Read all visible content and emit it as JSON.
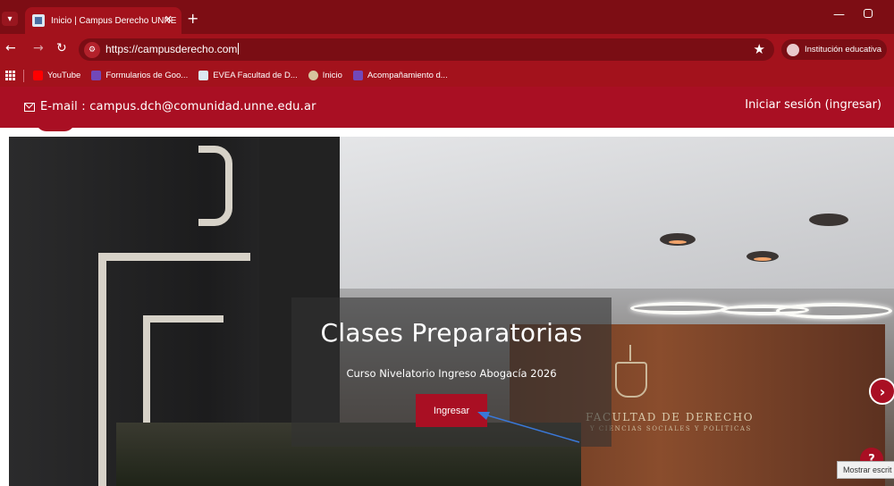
{
  "browser": {
    "tab": {
      "title": "Inicio | Campus Derecho UNNE",
      "close_glyph": "✕"
    },
    "new_tab_glyph": "+",
    "url": "https://campusderecho.com",
    "profile_label": "Institución educativa",
    "bookmarks": [
      {
        "label": "YouTube",
        "icon": "youtube-icon",
        "color": "#ff0000"
      },
      {
        "label": "Formularios de Goo...",
        "icon": "google-forms-icon",
        "color": "#7248b9"
      },
      {
        "label": "EVEA Facultad de D...",
        "icon": "evea-icon",
        "color": "#dce8f3"
      },
      {
        "label": "Inicio",
        "icon": "inicio-icon",
        "color": "#d7c49e"
      },
      {
        "label": "Acompañamiento d...",
        "icon": "google-forms-icon",
        "color": "#7248b9"
      }
    ]
  },
  "site": {
    "email": "E-mail : campus.dch@comunidad.unne.edu.ar",
    "login": "Iniciar sesión (ingresar)",
    "hero": {
      "title": "Clases Preparatorias",
      "subtitle": "Curso Nivelatorio Ingreso Abogacía 2026",
      "button": "Ingresar",
      "wall_text": "FACULTAD DE DERECHO",
      "wall_subtext": "Y CIENCIAS SOCIALES Y POLITICAS"
    },
    "next_glyph": "›",
    "help_glyph": "?",
    "tooltip": "Mostrar escrit"
  },
  "colors": {
    "chrome_dark": "#7d0d14",
    "chrome": "#a3121c",
    "brand": "#a90f23",
    "annotation_arrow": "#3a78d8"
  }
}
